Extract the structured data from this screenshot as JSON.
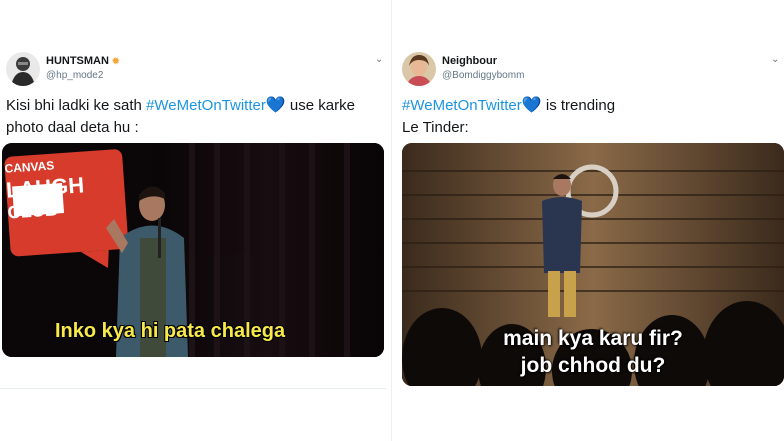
{
  "tweets": [
    {
      "display_name": "HUNTSMAN",
      "badge_icon": "star-icon",
      "handle": "@hp_mode2",
      "text_line1_before": "Kisi bhi ladki ke sath ",
      "hashtag": "#WeMetOnTwitter",
      "heart": "💙",
      "text_line1_after": " use karke",
      "text_line2": "photo daal deta hu :",
      "media": {
        "logo_line1": "CANVAS",
        "logo_line2": "LAUGH",
        "logo_line3": "CLUB",
        "caption": "Inko kya hi pata chalega"
      }
    },
    {
      "display_name": "Neighbour",
      "handle": "@Bomdiggybomm",
      "hashtag": "#WeMetOnTwitter",
      "heart": "💙",
      "text_line1_after": " is trending",
      "text_line2": "Le Tinder:",
      "media": {
        "caption_line1": "main kya karu fir?",
        "caption_line2": "job chhod du?"
      }
    }
  ],
  "colors": {
    "hashtag": "#1b95e0",
    "caption_left": "#f7e94a",
    "logo_red": "#d63b2b"
  }
}
